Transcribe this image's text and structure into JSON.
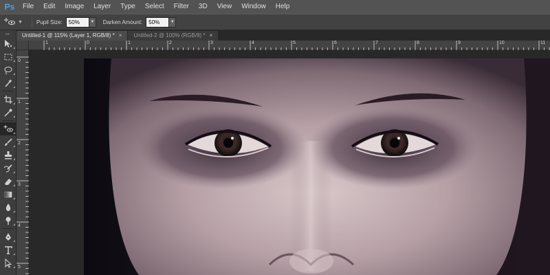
{
  "app": {
    "logo": "Ps"
  },
  "menu": [
    "File",
    "Edit",
    "Image",
    "Layer",
    "Type",
    "Select",
    "Filter",
    "3D",
    "View",
    "Window",
    "Help"
  ],
  "options": {
    "pupil_size_label": "Pupil Size:",
    "pupil_size_value": "50%",
    "darken_amount_label": "Darken Amount:",
    "darken_amount_value": "50%"
  },
  "tabs": [
    {
      "label": "Untitled-1 @ 115% (Layer 1, RGB/8) *",
      "close": "×"
    },
    {
      "label": "Untitled-2 @ 100% (RGB/8) *",
      "close": "×"
    }
  ],
  "ruler": {
    "horizontal": [
      "1",
      "0",
      "1",
      "2",
      "3",
      "4",
      "5",
      "6",
      "7",
      "8",
      "9",
      "10",
      "11"
    ],
    "vertical": [
      "0",
      "1",
      "2",
      "3",
      "4",
      "5"
    ]
  },
  "tools": [
    "move-tool-icon",
    "marquee-tool-icon",
    "lasso-tool-icon",
    "quick-selection-tool-icon",
    "crop-tool-icon",
    "eyedropper-tool-icon",
    "red-eye-tool-icon",
    "brush-tool-icon",
    "clone-stamp-tool-icon",
    "history-brush-tool-icon",
    "eraser-tool-icon",
    "gradient-tool-icon",
    "blur-tool-icon",
    "dodge-tool-icon",
    "pen-tool-icon",
    "type-tool-icon",
    "path-selection-tool-icon"
  ],
  "colors": {
    "menubar": "#535353",
    "optionsbar": "#424242",
    "workspace": "#282828",
    "accent": "#4aa3df"
  }
}
